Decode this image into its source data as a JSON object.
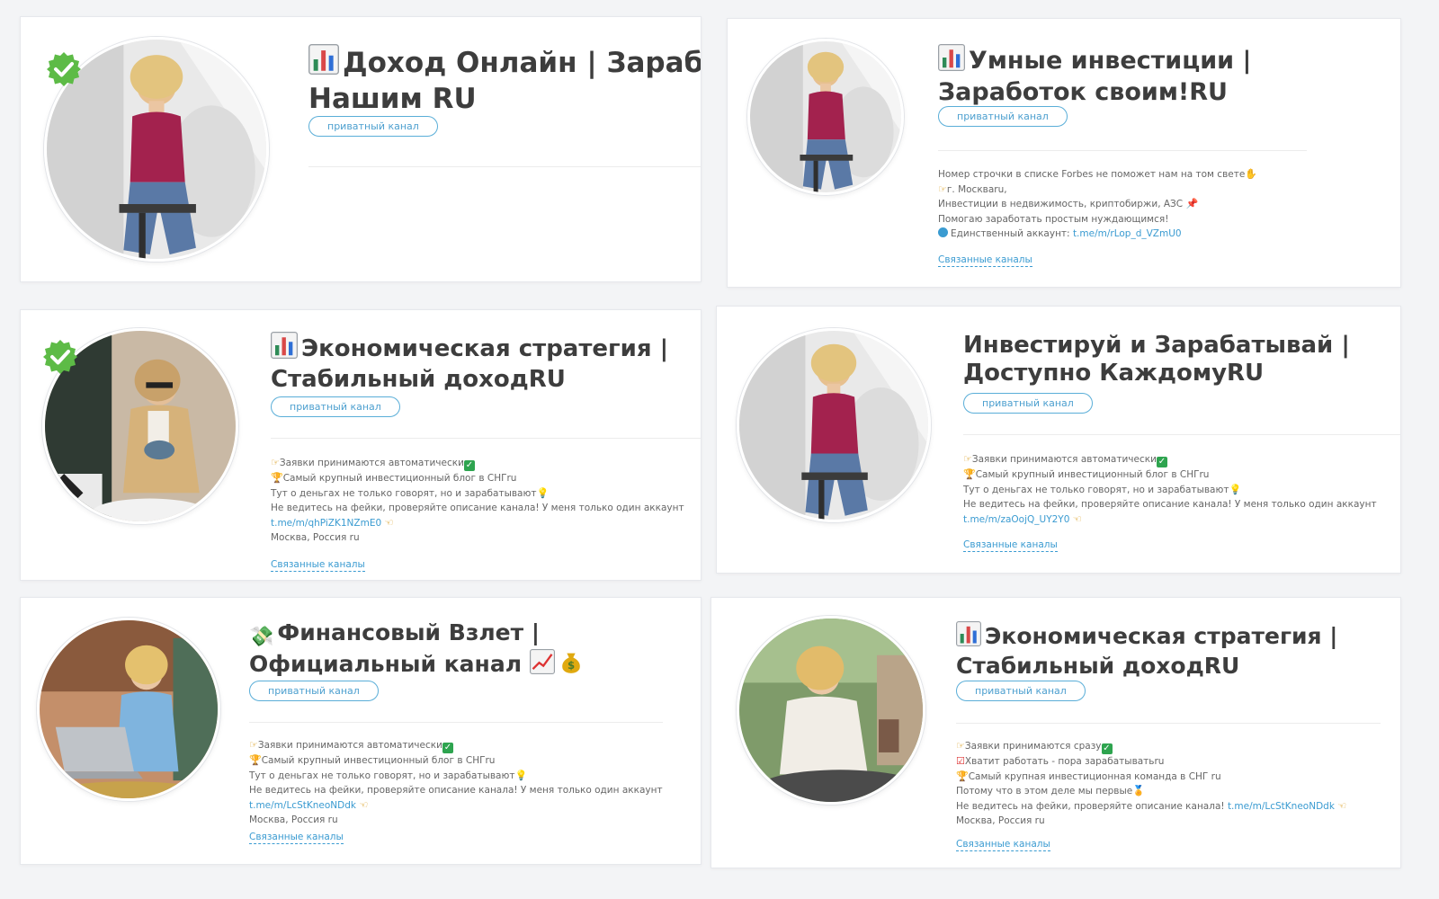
{
  "colors": {
    "accent": "#3a9bd1",
    "badge_border": "#5aaed8",
    "verified": "#5dbb46",
    "title": "#3d3d3d",
    "card_bg": "#ffffff",
    "page_bg": "#f3f4f6"
  },
  "cards": [
    {
      "title_line1": "Доход Онлайн | Заработо",
      "title_line2": "Нашим RU",
      "badge": "приватный канал",
      "verified": true,
      "title_icon": "chart-icon"
    },
    {
      "title_line1": "Умные инвестиции |",
      "title_line2": "Заработок своим!RU",
      "badge": "приватный канал",
      "verified": false,
      "title_icon": "chart-icon",
      "desc": [
        "Номер строчки в списке Forbes не поможет нам на том свете",
        "г. Москваru,",
        "Инвестиции в недвижимость, криптобиржи, АЗС",
        "Помогаю заработать простым нуждающимся!",
        "Единственный аккаунт: "
      ],
      "link": "t.me/m/rLop_d_VZmU0",
      "related": "Связанные каналы"
    },
    {
      "title_line1": "Экономическая стратегия |",
      "title_line2": "Стабильный доходRU",
      "badge": "приватный канал",
      "verified": true,
      "title_icon": "chart-icon",
      "desc": [
        "Заявки принимаются автоматически",
        "Самый крупный инвестиционный блог в СНГru",
        "Тут о деньгах не только говорят, но и зарабатывают",
        "Не ведитесь на фейки, проверяйте описание канала! У меня только один аккаунт",
        "Москва, Россия ru"
      ],
      "link": "t.me/m/qhPiZK1NZmE0",
      "related": "Связанные каналы"
    },
    {
      "title_line1": "Инвестируй и Зарабатывай |",
      "title_line2": "Доступно КаждомуRU",
      "badge": "приватный канал",
      "verified": false,
      "desc": [
        "Заявки принимаются автоматически",
        "Самый крупный инвестиционный блог в СНГru",
        "Тут о деньгах не только говорят, но и зарабатывают",
        "Не ведитесь на фейки, проверяйте описание канала! У меня только один аккаунт"
      ],
      "link": "t.me/m/zaOojQ_UY2Y0",
      "related": "Связанные каналы"
    },
    {
      "title_line1": "Финансовый Взлет |",
      "title_line2": "Официальный канал",
      "badge": "приватный канал",
      "verified": false,
      "title_icon": "money-icon",
      "desc": [
        "Заявки принимаются автоматически",
        "Самый крупный инвестиционный блог в СНГru",
        "Тут о деньгах не только говорят, но и зарабатывают",
        "Не ведитесь на фейки, проверяйте описание канала! У меня только один аккаунт",
        "Москва, Россия ru"
      ],
      "link": "t.me/m/LcStKneoNDdk",
      "related": "Связанные каналы"
    },
    {
      "title_line1": "Экономическая стратегия |",
      "title_line2": "Стабильный доходRU",
      "badge": "приватный канал",
      "verified": false,
      "title_icon": "chart-icon",
      "desc": [
        "Заявки принимаются сразу",
        "Хватит работать - пора зарабатыватьru",
        "Самый крупная инвестиционная команда в СНГ ru",
        "Потому что в этом деле мы первые",
        "Не ведитесь на фейки, проверяйте описание канала! ",
        "Москва, Россия ru"
      ],
      "link": "t.me/m/LcStKneoNDdk",
      "related": "Связанные каналы"
    }
  ]
}
